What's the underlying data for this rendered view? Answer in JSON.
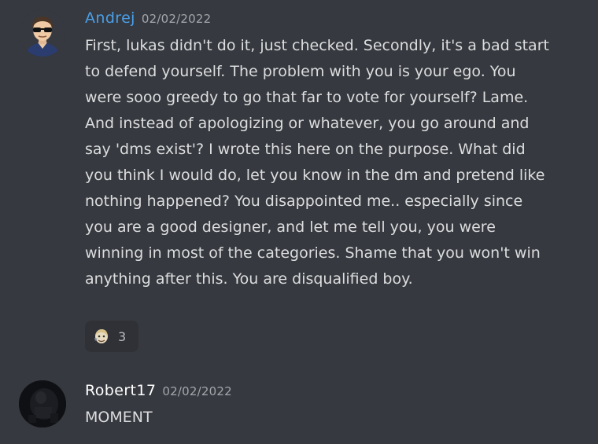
{
  "messages": [
    {
      "author": "Andrej",
      "author_color": "#4a9fe8",
      "timestamp": "02/02/2022",
      "avatar_icon": "sunglasses-person-avatar",
      "text": "First, lukas didn't do it, just checked. Secondly, it's a bad start to defend yourself. The problem with you is your ego. You were sooo greedy to go that far to vote for yourself? Lame. And instead of apologizing or whatever, you go around and say 'dms exist'? I wrote this here on the purpose. What did you think I would do, let you know in the dm and pretend like nothing happened? You disappointed me.. especially since you are a good designer, and let me tell you, you were winning in most of the categories. Shame that you won't win anything after this. You are disqualified boy.",
      "reaction": {
        "emoji_icon": "custom-emoji",
        "count": "3"
      }
    },
    {
      "author": "Robert17",
      "author_color": "#ffffff",
      "timestamp": "02/02/2022",
      "avatar_icon": "dark-photo-avatar",
      "text": "MOMENT"
    }
  ],
  "colors": {
    "background": "#36393f",
    "reaction_background": "#2f3136",
    "timestamp": "#a3a6aa",
    "message_text": "#dcddde"
  }
}
